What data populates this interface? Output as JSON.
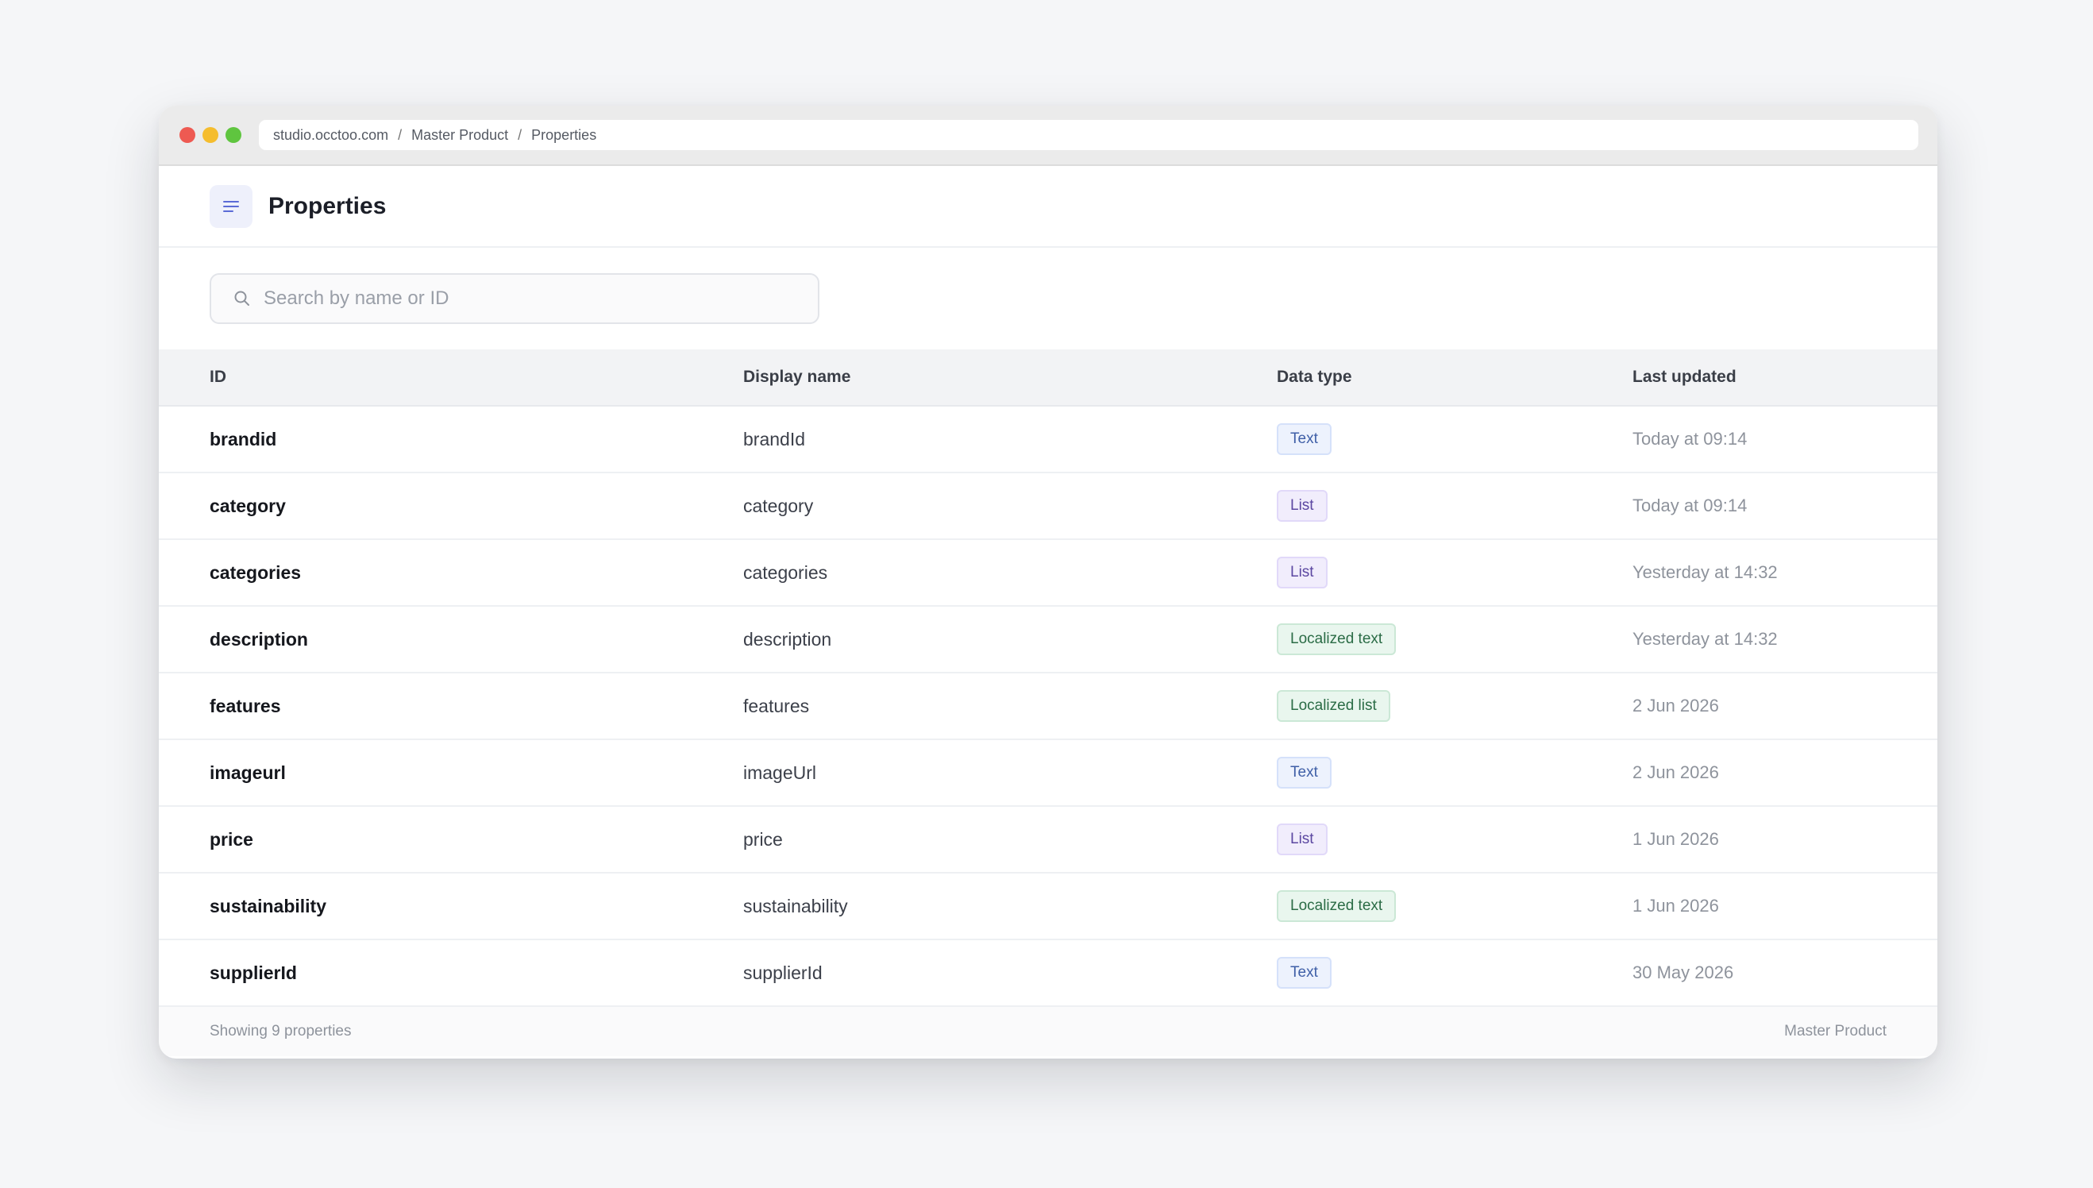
{
  "browser": {
    "breadcrumb": [
      "studio.occtoo.com",
      "Master Product",
      "Properties"
    ],
    "separator": "/"
  },
  "header": {
    "title": "Properties",
    "menu_icon": "menu-lines-icon"
  },
  "search": {
    "placeholder": "Search by name or ID",
    "value": "",
    "icon": "search-icon"
  },
  "table": {
    "columns": [
      "ID",
      "Display name",
      "Data type",
      "Last updated"
    ],
    "rows": [
      {
        "id": "brandid",
        "display_name": "brandId",
        "data_type": "Text",
        "type_kind": "text",
        "last_updated": "Today at 09:14"
      },
      {
        "id": "category",
        "display_name": "category",
        "data_type": "List",
        "type_kind": "list",
        "last_updated": "Today at 09:14"
      },
      {
        "id": "categories",
        "display_name": "categories",
        "data_type": "List",
        "type_kind": "list",
        "last_updated": "Yesterday at 14:32"
      },
      {
        "id": "description",
        "display_name": "description",
        "data_type": "Localized text",
        "type_kind": "loc",
        "last_updated": "Yesterday at 14:32"
      },
      {
        "id": "features",
        "display_name": "features",
        "data_type": "Localized list",
        "type_kind": "loc",
        "last_updated": "2 Jun 2026"
      },
      {
        "id": "imageurl",
        "display_name": "imageUrl",
        "data_type": "Text",
        "type_kind": "text",
        "last_updated": "2 Jun 2026"
      },
      {
        "id": "price",
        "display_name": "price",
        "data_type": "List",
        "type_kind": "list",
        "last_updated": "1 Jun 2026"
      },
      {
        "id": "sustainability",
        "display_name": "sustainability",
        "data_type": "Localized text",
        "type_kind": "loc",
        "last_updated": "1 Jun 2026"
      },
      {
        "id": "supplierId",
        "display_name": "supplierId",
        "data_type": "Text",
        "type_kind": "text",
        "last_updated": "30 May 2026"
      }
    ]
  },
  "footer": {
    "count_text": "Showing 9 properties",
    "context": "Master Product"
  },
  "colors": {
    "accent": "#5b6bd6",
    "badge_text": "#3f5fa7",
    "badge_list": "#5b47a1",
    "badge_localized": "#2b6c46"
  }
}
